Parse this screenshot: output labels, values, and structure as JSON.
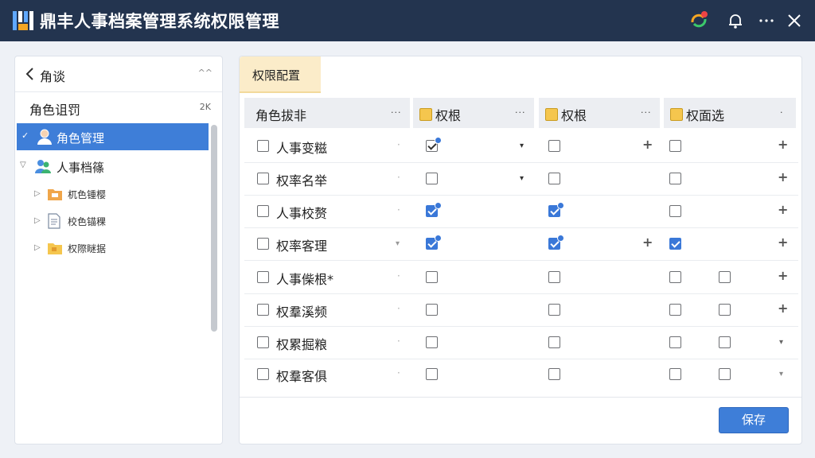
{
  "app": {
    "title": "鼎丰人事档案管理系统权限管理"
  },
  "sidebar": {
    "back_label": "角谈",
    "caret": "^^",
    "section_title": "角色诅罚",
    "count": "2K",
    "tree": [
      {
        "label": "角色管理",
        "selected": true,
        "mark": "✓"
      },
      {
        "label": "人事档篠",
        "expand": "▽"
      },
      {
        "label": "杌色锺樱",
        "expand": "▷"
      },
      {
        "label": "校色锚稞",
        "expand": "▷"
      },
      {
        "label": "权際瞇据",
        "expand": "▷"
      }
    ]
  },
  "panel": {
    "tab_label": "权限配置",
    "columns": [
      {
        "label": "角色拔非",
        "dots": "···"
      },
      {
        "label": "权根",
        "dots": "···"
      },
      {
        "label": "权根",
        "dots": "···"
      },
      {
        "label": "权面选",
        "dots": "·"
      }
    ],
    "rows": [
      {
        "label": "人事变糍",
        "row_dot": "·"
      },
      {
        "label": "权率名举",
        "row_dot": "·"
      },
      {
        "label": "人事校赘",
        "row_dot": "·"
      },
      {
        "label": "权率客理",
        "row_dot": "·"
      },
      {
        "label": "人事偨根*",
        "row_dot": "·"
      },
      {
        "label": "权羣溪频",
        "row_dot": "·"
      },
      {
        "label": "权累掘粮",
        "row_dot": "·"
      },
      {
        "label": "权羣客俱",
        "row_dot": "·"
      }
    ],
    "plus_symbol": "+",
    "dropdown_symbol": "▾"
  },
  "footer": {
    "save_label": "保存"
  },
  "colors": {
    "titlebar": "#23344f",
    "accent": "#3e7ed8",
    "tab": "#fbecc9"
  }
}
